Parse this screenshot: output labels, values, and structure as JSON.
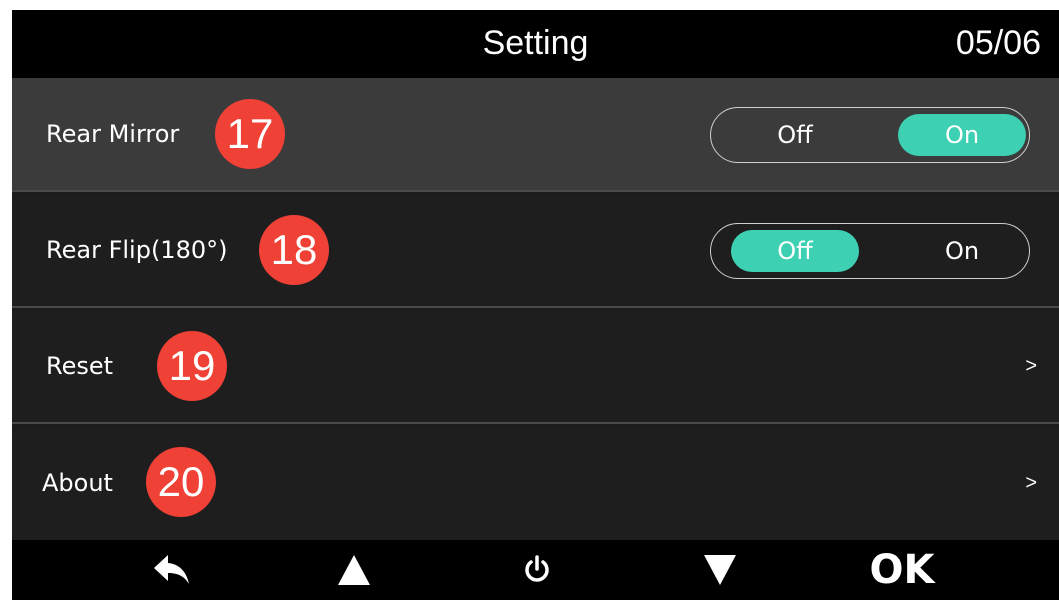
{
  "header": {
    "title": "Setting",
    "page_indicator": "05/06"
  },
  "settings": [
    {
      "label": "Rear Mirror",
      "badge": "17",
      "type": "toggle",
      "options": [
        "Off",
        "On"
      ],
      "selected_option": "On",
      "selected": true
    },
    {
      "label": "Rear Flip(180°)",
      "badge": "18",
      "type": "toggle",
      "options": [
        "Off",
        "On"
      ],
      "selected_option": "Off",
      "selected": false
    },
    {
      "label": "Reset",
      "badge": "19",
      "type": "link",
      "chevron": ">"
    },
    {
      "label": "About",
      "badge": "20",
      "type": "link",
      "chevron": ">"
    }
  ],
  "footer": {
    "buttons": [
      {
        "name": "back",
        "icon": "back-arrow-icon"
      },
      {
        "name": "up",
        "icon": "triangle-up-icon"
      },
      {
        "name": "power",
        "icon": "power-icon"
      },
      {
        "name": "down",
        "icon": "triangle-down-icon"
      },
      {
        "name": "ok",
        "label": "OK"
      }
    ]
  },
  "colors": {
    "accent": "#3dd0b2",
    "badge": "#ef4136",
    "selected_row": "#3b3b3b"
  }
}
